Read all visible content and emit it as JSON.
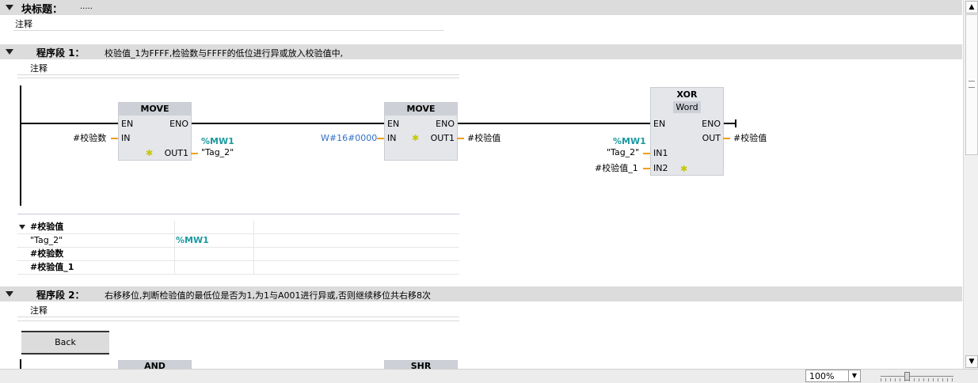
{
  "block_title": {
    "label": "块标题：",
    "value": "....."
  },
  "block_comment": "注释",
  "networks": [
    {
      "label": "程序段 1：",
      "title": "校验值_1为FFFF,检验数与FFFF的低位进行异或放入校验值中,",
      "comment": "注释"
    },
    {
      "label": "程序段 2：",
      "title": "右移移位,判断检验值的最低位是否为1,为1与A001进行异或,否则继续移位共右移8次",
      "comment": "注释"
    }
  ],
  "ladder": {
    "move1": {
      "title": "MOVE",
      "en": "EN",
      "eno": "ENO",
      "in": "IN",
      "out1": "OUT1",
      "in_operand": "#校验数",
      "out_addr": "%MW1",
      "out_operand": "\"Tag_2\""
    },
    "move2": {
      "title": "MOVE",
      "en": "EN",
      "eno": "ENO",
      "in": "IN",
      "out1": "OUT1",
      "in_operand": "W#16#0000",
      "out_operand": "#校验值"
    },
    "xor": {
      "title": "XOR",
      "type": "Word",
      "en": "EN",
      "eno": "ENO",
      "out": "OUT",
      "in1": "IN1",
      "in2": "IN2",
      "out_operand": "#校验值",
      "in1_addr": "%MW1",
      "in1_operand": "\"Tag_2\"",
      "in2_operand": "#校验值_1"
    }
  },
  "operand_table": [
    {
      "name": "#校验值",
      "addr": ""
    },
    {
      "name": "\"Tag_2\"",
      "addr": "%MW1"
    },
    {
      "name": "#校验数",
      "addr": ""
    },
    {
      "name": "#校验值_1",
      "addr": ""
    }
  ],
  "back_button": "Back",
  "network2_boxes": {
    "and": "AND",
    "shr": "SHR"
  },
  "zoom": {
    "value": "100%"
  },
  "colors": {
    "band": "#dcdcdc",
    "teal": "#1a9aa0",
    "blue": "#3070c8",
    "wire": "#f0a000"
  }
}
